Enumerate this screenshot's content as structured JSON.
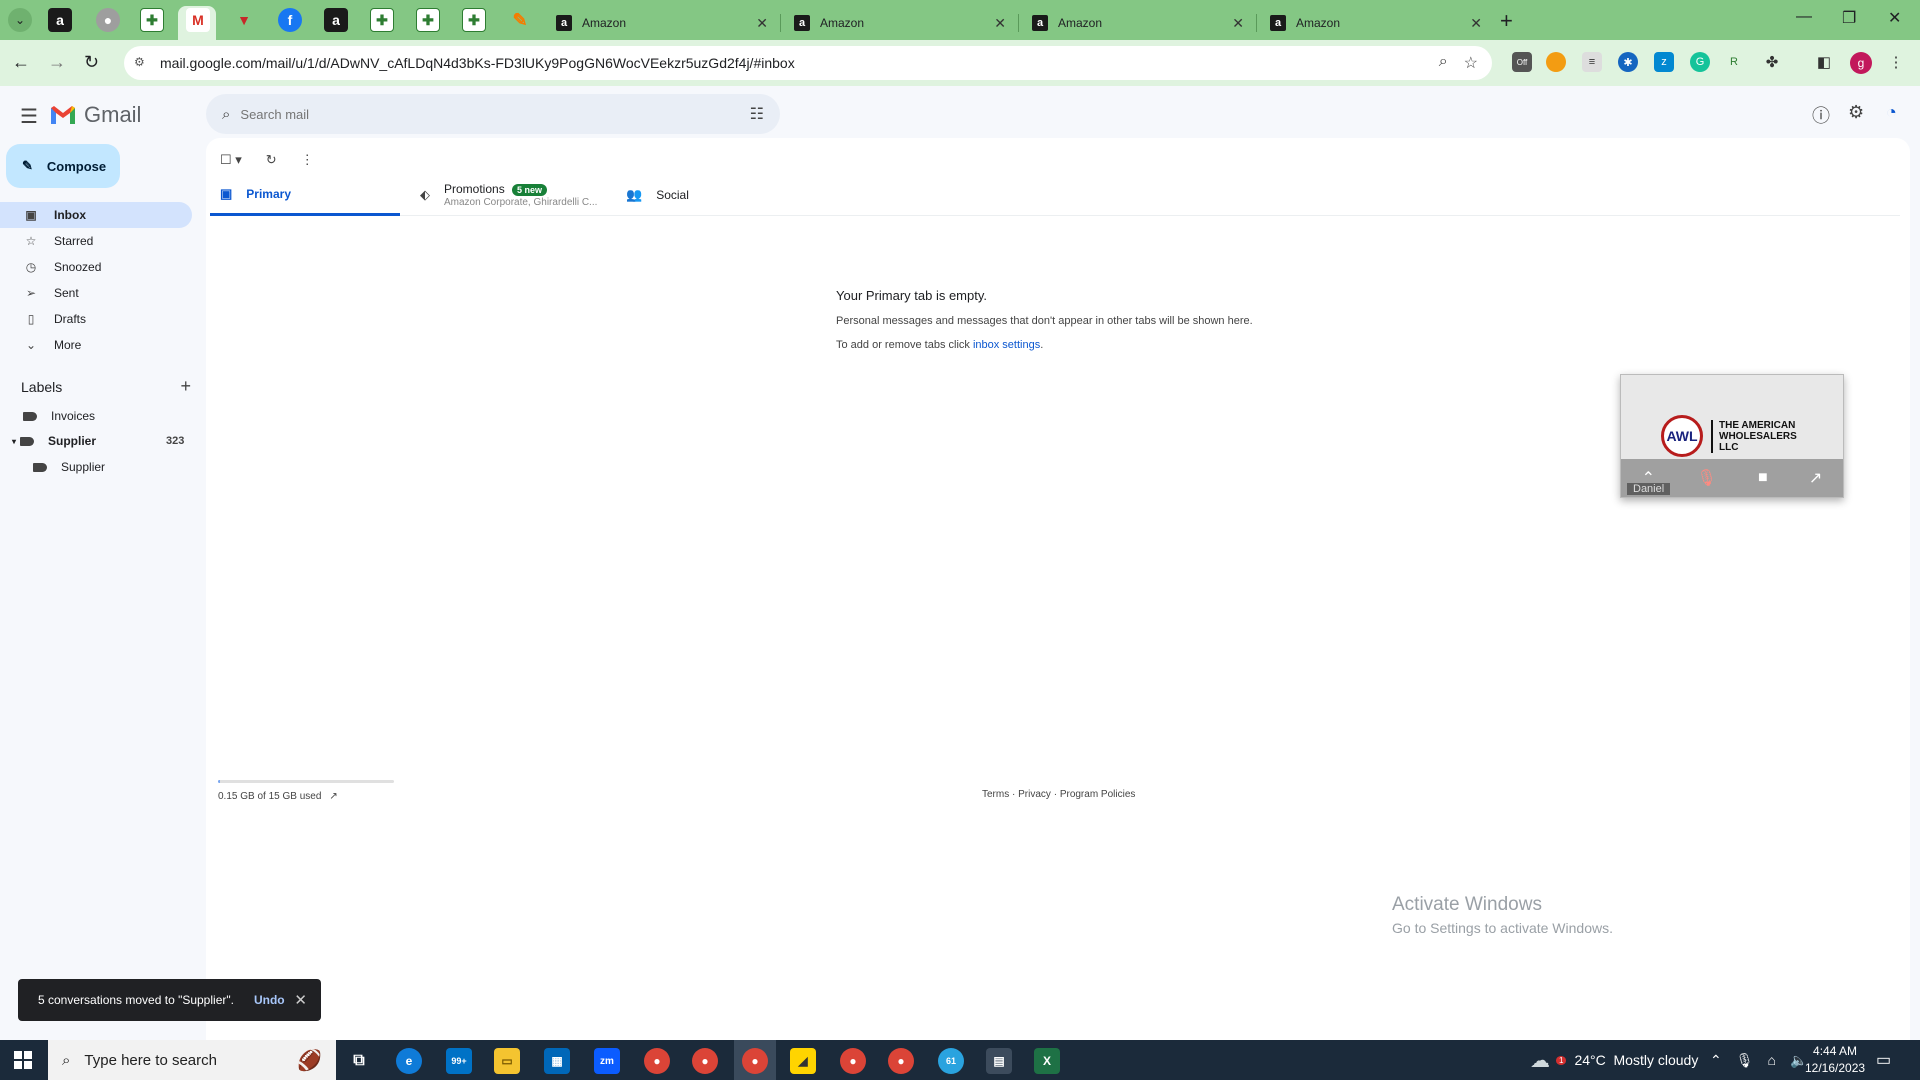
{
  "browser": {
    "tabs": [
      {
        "label": "Amazon"
      },
      {
        "label": "Amazon"
      },
      {
        "label": "Amazon"
      },
      {
        "label": "Amazon"
      }
    ],
    "url": "mail.google.com/mail/u/1/d/ADwNV_cAfLDqN4d3bKs-FD3lUKy9PogGN6WocVEekzr5uzGd2f4j/#inbox",
    "profile_initial": "g",
    "ext_off_label": "Off"
  },
  "gmail": {
    "logo_text": "Gmail",
    "search_placeholder": "Search mail",
    "compose_label": "Compose",
    "nav": [
      {
        "label": "Inbox"
      },
      {
        "label": "Starred"
      },
      {
        "label": "Snoozed"
      },
      {
        "label": "Sent"
      },
      {
        "label": "Drafts"
      },
      {
        "label": "More"
      }
    ],
    "labels_title": "Labels",
    "labels": [
      {
        "label": "Invoices",
        "count": ""
      },
      {
        "label": "Supplier",
        "count": "323"
      },
      {
        "label": "Supplier",
        "count": ""
      }
    ],
    "category_tabs": {
      "primary": "Primary",
      "promotions": "Promotions",
      "promotions_badge": "5 new",
      "promotions_senders": "Amazon Corporate, Ghirardelli C...",
      "social": "Social"
    },
    "empty": {
      "title": "Your Primary tab is empty.",
      "line1": "Personal messages and messages that don't appear in other tabs will be shown here.",
      "line2_prefix": "To add or remove tabs click ",
      "line2_link": "inbox settings",
      "line2_suffix": "."
    },
    "storage": {
      "text": "0.15 GB of 15 GB used",
      "used_fraction": 0.01
    },
    "footer": {
      "terms": "Terms",
      "privacy": "Privacy",
      "policies": "Program Policies",
      "sep": " · "
    },
    "snackbar": {
      "message": "5 conversations moved to \"Supplier\".",
      "undo": "Undo"
    }
  },
  "video_overlay": {
    "logo_mark": "AWL",
    "brand": "THE AMERICAN WHOLESALERS LLC",
    "participant": "Daniel"
  },
  "watermark": {
    "line1": "Activate Windows",
    "line2": "Go to Settings to activate Windows."
  },
  "taskbar": {
    "search_placeholder": "Type here to search",
    "mail_badge": "99+",
    "telegram_badge": "61",
    "weather": "24°C  Mostly cloudy",
    "weather_badge": "1",
    "time": "4:44 AM",
    "date": "12/16/2023"
  }
}
